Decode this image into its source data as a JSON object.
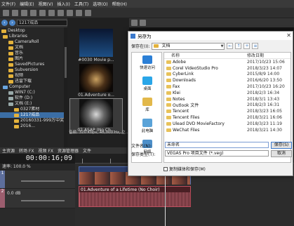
{
  "menubar": {
    "items": [
      "文件(F)",
      "编辑(E)",
      "视图(V)",
      "插入(I)",
      "工具(T)",
      "选项(O)",
      "帮助(H)"
    ]
  },
  "explorer": {
    "path": "1217成品",
    "tree": [
      {
        "label": "Desktop",
        "selected": false
      },
      {
        "label": "Libraries",
        "selected": false
      },
      {
        "label": "CameraRoll",
        "selected": false
      },
      {
        "label": "文档",
        "selected": false
      },
      {
        "label": "音乐",
        "selected": false
      },
      {
        "label": "图片",
        "selected": false
      },
      {
        "label": "SavedPictures",
        "selected": false
      },
      {
        "label": "Subversion",
        "selected": false
      },
      {
        "label": "视频",
        "selected": false
      },
      {
        "label": "迅雷下载",
        "selected": false
      },
      {
        "label": "Computer",
        "selected": false
      },
      {
        "label": "WIN7 (C:)",
        "selected": false
      },
      {
        "label": "软件 (D:)",
        "selected": false
      },
      {
        "label": "文档 (E:)",
        "selected": false
      },
      {
        "label": "0327素材",
        "selected": false
      },
      {
        "label": "1217成品",
        "selected": true
      },
      {
        "label": "20160331-999万中奖",
        "selected": false
      },
      {
        "label": "2016...",
        "selected": false
      }
    ]
  },
  "media": {
    "items": [
      {
        "caption": "#0030 Movie p...",
        "selected": false
      },
      {
        "caption": "01.Adventure o...",
        "selected": false
      },
      {
        "caption": "02.ASAP (No Ch...",
        "selected": true
      }
    ],
    "info": "音频: 320 Kbps, 48,000 Hz, 立..."
  },
  "tabs": [
    "主资源",
    "转场 FX",
    "视频 FX",
    "资源管理器",
    "文件"
  ],
  "timeline": {
    "timecode": "00:00:16;09",
    "rate_label": "速率: 100.0 %",
    "track1_num": "1",
    "track2_num": "2",
    "track2_level": "0.0 dB",
    "audio_clip_label": "01.Adventure of a Lifetime (No Choir)"
  },
  "dialog": {
    "title": "另存为",
    "save_in_label": "保存在(I):",
    "save_in_value": "文档",
    "col_name": "名称",
    "col_date": "修改日期",
    "places": [
      "快速访问",
      "桌面",
      "库",
      "此电脑",
      "网络"
    ],
    "files": [
      {
        "name": "Adobe",
        "date": "2017/10/23 15:06"
      },
      {
        "name": "Corel VideoStudio Pro",
        "date": "2018/3/23 14:07"
      },
      {
        "name": "CyberLink",
        "date": "2015/8/9 14:00"
      },
      {
        "name": "Downloads",
        "date": "2016/6/20 13:50"
      },
      {
        "name": "Fax",
        "date": "2017/10/23 16:20"
      },
      {
        "name": "Klei",
        "date": "2018/2/3 16:34"
      },
      {
        "name": "Notes",
        "date": "2018/3/1 13:43"
      },
      {
        "name": "Outlook 文件",
        "date": "2018/2/3 16:31"
      },
      {
        "name": "Tencent",
        "date": "2018/3/23 16:05"
      },
      {
        "name": "Tencent Files",
        "date": "2018/3/21 16:06"
      },
      {
        "name": "Ulead DVD MovieFactory",
        "date": "2018/3/23 11:19"
      },
      {
        "name": "WeChat Files",
        "date": "2018/3/21 14:30"
      }
    ],
    "filename_label": "文件名(N):",
    "filename_value": "未命名",
    "filetype_label": "保存类型(T):",
    "filetype_value": "VEGAS Pro 项目文件 (*.veg)",
    "save_button": "保存(S)",
    "cancel_button": "取消",
    "checkbox_label": "复制媒体和保存(M)"
  }
}
